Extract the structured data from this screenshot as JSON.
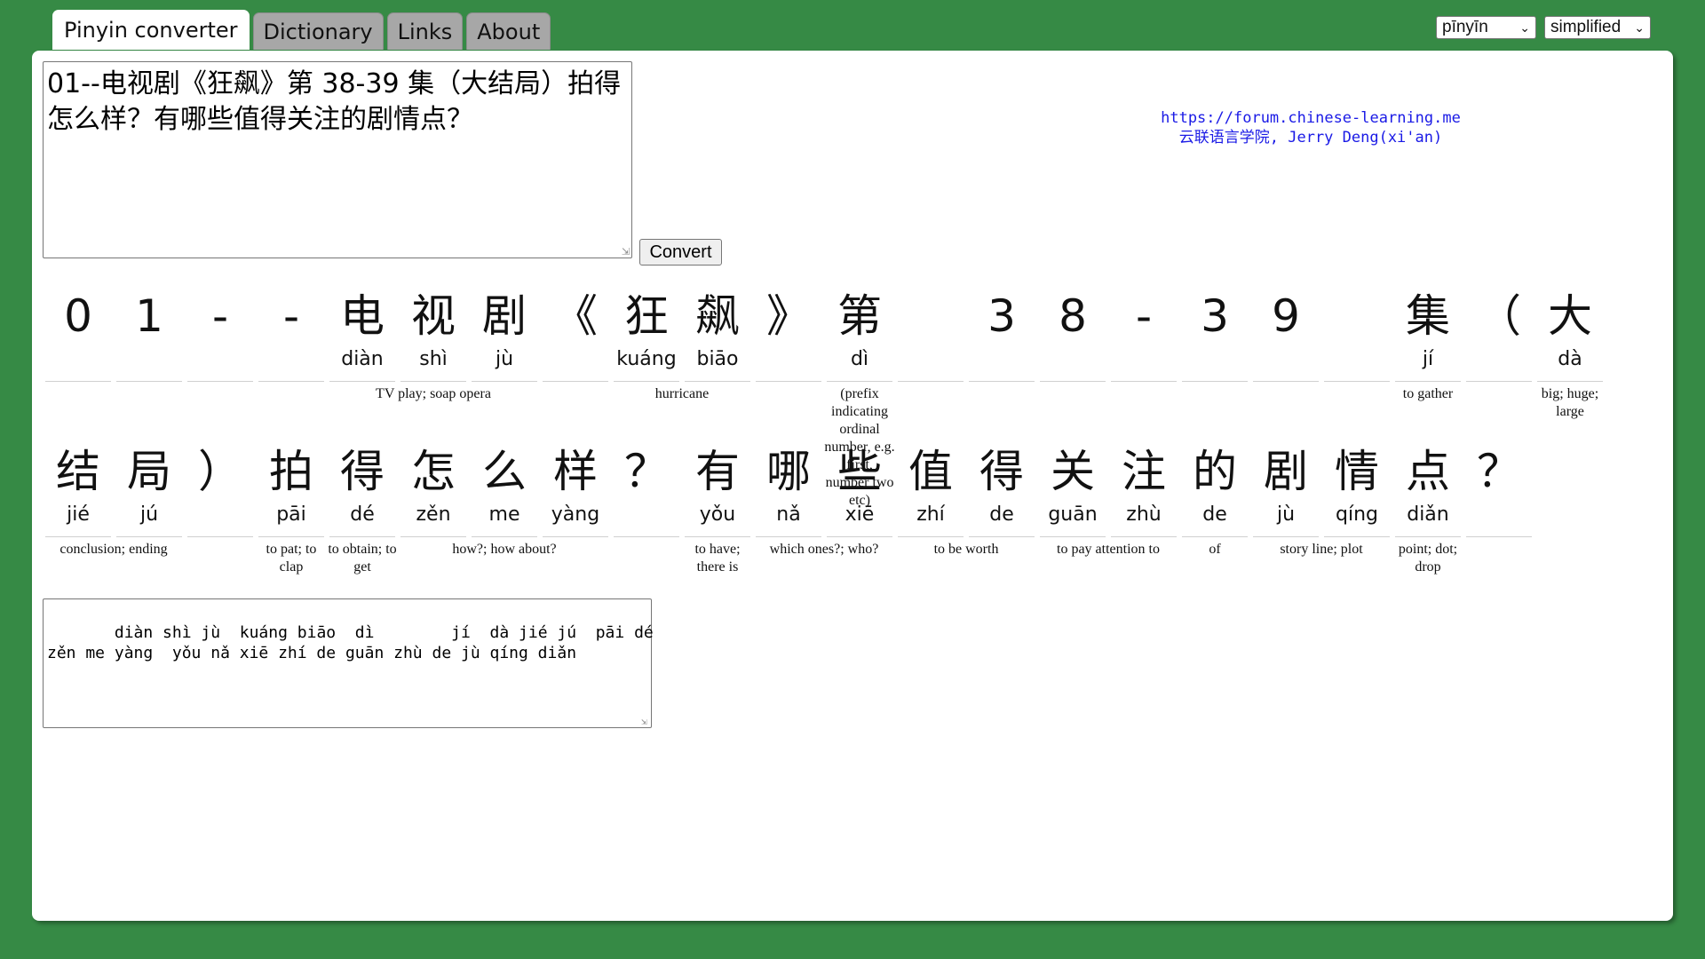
{
  "tabs": [
    {
      "label": "Pinyin converter",
      "active": true
    },
    {
      "label": "Dictionary",
      "active": false
    },
    {
      "label": "Links",
      "active": false
    },
    {
      "label": "About",
      "active": false
    }
  ],
  "selects": {
    "romanization": "pīnyīn",
    "script": "simplified"
  },
  "input": {
    "text": "01--电视剧《狂飙》第 38-39 集（大结局）拍得怎么样？有哪些值得关注的剧情点？"
  },
  "convert_label": "Convert",
  "credits": {
    "line1": "https://forum.chinese-learning.me",
    "line2": "云联语言学院, Jerry Deng(xi'an)"
  },
  "rows": [
    {
      "cells": [
        {
          "ch": "0",
          "py": ""
        },
        {
          "ch": "1",
          "py": ""
        },
        {
          "ch": "-",
          "py": ""
        },
        {
          "ch": "-",
          "py": ""
        },
        {
          "ch": "电",
          "py": "diàn"
        },
        {
          "ch": "视",
          "py": "shì"
        },
        {
          "ch": "剧",
          "py": "jù"
        },
        {
          "ch": "《",
          "py": ""
        },
        {
          "ch": "狂",
          "py": "kuáng"
        },
        {
          "ch": "飙",
          "py": "biāo"
        },
        {
          "ch": "》",
          "py": ""
        },
        {
          "ch": "第",
          "py": "dì"
        },
        {
          "ch": "",
          "py": ""
        },
        {
          "ch": "3",
          "py": ""
        },
        {
          "ch": "8",
          "py": ""
        },
        {
          "ch": "-",
          "py": ""
        },
        {
          "ch": "3",
          "py": ""
        },
        {
          "ch": "9",
          "py": ""
        },
        {
          "ch": "",
          "py": ""
        },
        {
          "ch": "集",
          "py": "jí"
        },
        {
          "ch": "（",
          "py": ""
        },
        {
          "ch": "大",
          "py": "dà"
        }
      ],
      "defs": [
        {
          "text": "TV play; soap opera",
          "start": 4,
          "span": 3
        },
        {
          "text": "hurricane",
          "start": 8,
          "span": 2
        },
        {
          "text": "(prefix indicating ordinal number, e.g. first, number two etc)",
          "start": 11,
          "span": 1
        },
        {
          "text": "to gather",
          "start": 19,
          "span": 1
        },
        {
          "text": "big; huge; large",
          "start": 21,
          "span": 1
        }
      ]
    },
    {
      "cells": [
        {
          "ch": "结",
          "py": "jié"
        },
        {
          "ch": "局",
          "py": "jú"
        },
        {
          "ch": "）",
          "py": ""
        },
        {
          "ch": "拍",
          "py": "pāi"
        },
        {
          "ch": "得",
          "py": "dé"
        },
        {
          "ch": "怎",
          "py": "zěn"
        },
        {
          "ch": "么",
          "py": "me"
        },
        {
          "ch": "样",
          "py": "yàng"
        },
        {
          "ch": "？",
          "py": ""
        },
        {
          "ch": "有",
          "py": "yǒu"
        },
        {
          "ch": "哪",
          "py": "nǎ"
        },
        {
          "ch": "些",
          "py": "xiē"
        },
        {
          "ch": "值",
          "py": "zhí"
        },
        {
          "ch": "得",
          "py": "de"
        },
        {
          "ch": "关",
          "py": "guān"
        },
        {
          "ch": "注",
          "py": "zhù"
        },
        {
          "ch": "的",
          "py": "de"
        },
        {
          "ch": "剧",
          "py": "jù"
        },
        {
          "ch": "情",
          "py": "qíng"
        },
        {
          "ch": "点",
          "py": "diǎn"
        },
        {
          "ch": "？",
          "py": ""
        }
      ],
      "defs": [
        {
          "text": "conclusion; ending",
          "start": 0,
          "span": 2
        },
        {
          "text": "to pat; to clap",
          "start": 3,
          "span": 1
        },
        {
          "text": "to obtain; to get",
          "start": 4,
          "span": 1
        },
        {
          "text": "how?; how about?",
          "start": 5,
          "span": 3
        },
        {
          "text": "to have; there is",
          "start": 9,
          "span": 1
        },
        {
          "text": "which ones?; who?",
          "start": 10,
          "span": 2
        },
        {
          "text": "to be worth",
          "start": 12,
          "span": 2
        },
        {
          "text": "to pay attention to",
          "start": 14,
          "span": 2
        },
        {
          "text": "of",
          "start": 16,
          "span": 1
        },
        {
          "text": "story line; plot",
          "start": 17,
          "span": 2
        },
        {
          "text": "point; dot; drop",
          "start": 19,
          "span": 1
        }
      ]
    }
  ],
  "output": {
    "text": "   diàn shì jù  kuáng biāo  dì        jí  dà jié jú  pāi dé\nzěn me yàng  yǒu nǎ xiē zhí de guān zhù de jù qíng diǎn"
  }
}
